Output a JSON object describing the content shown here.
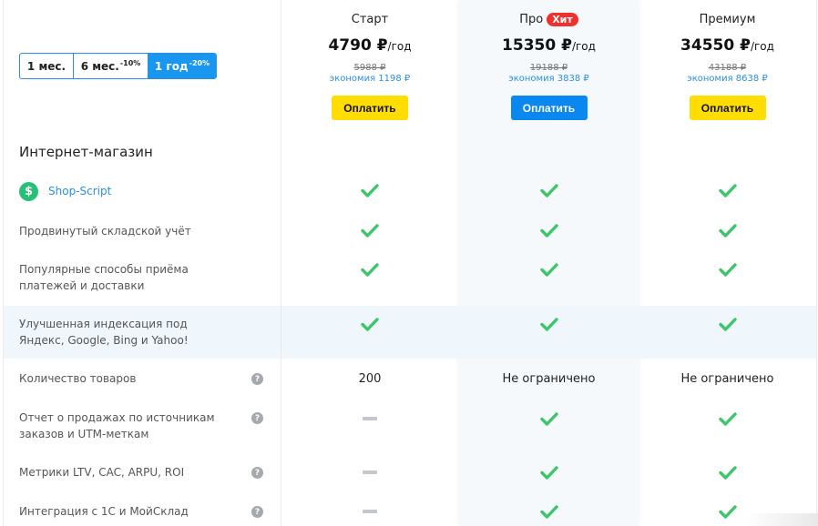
{
  "period_switch": {
    "options": [
      {
        "label": "1 мес.",
        "discount": ""
      },
      {
        "label": "6 мес.",
        "discount": "-10%"
      },
      {
        "label": "1 год",
        "discount": "-20%"
      }
    ],
    "active": "1 год"
  },
  "plans": [
    {
      "name": "Старт",
      "badge": "",
      "price": "4790 ₽",
      "per": "/год",
      "old_price": "5988 ₽",
      "savings": "экономия 1198 ₽",
      "button": "Оплатить",
      "button_color": "#ffdd00"
    },
    {
      "name": "Про",
      "badge": "Хит",
      "price": "15350 ₽",
      "per": "/год",
      "old_price": "19188 ₽",
      "savings": "экономия 3838 ₽",
      "button": "Оплатить",
      "button_color": "#0b87f0"
    },
    {
      "name": "Премиум",
      "badge": "",
      "price": "34550 ₽",
      "per": "/год",
      "old_price": "43188 ₽",
      "savings": "экономия 8638 ₽",
      "button": "Оплатить",
      "button_color": "#ffdd00"
    }
  ],
  "section_title": "Интернет-магазин",
  "features": [
    {
      "label": "Shop-Script",
      "icon": "dollar-icon",
      "is_link": true,
      "help": false,
      "values": [
        "check",
        "check",
        "check"
      ]
    },
    {
      "label_lines": [
        "Продвинутый складской учёт"
      ],
      "help": false,
      "values": [
        "check",
        "check",
        "check"
      ]
    },
    {
      "label_lines": [
        "Популярные способы приёма",
        "платежей и доставки"
      ],
      "help": false,
      "values": [
        "check",
        "check",
        "check"
      ]
    },
    {
      "label_lines": [
        "Улучшенная индексация под",
        "Яндекс, Google, Bing и Yahoo!"
      ],
      "help": false,
      "highlight": true,
      "values": [
        "check",
        "check",
        "check"
      ]
    },
    {
      "label_lines": [
        "Количество товаров"
      ],
      "help": true,
      "values": [
        "200",
        "Не ограничено",
        "Не ограничено"
      ]
    },
    {
      "label_lines": [
        "Отчет о продажах по источникам",
        "заказов и UTM-меткам"
      ],
      "help": true,
      "values": [
        "dash",
        "check",
        "check"
      ]
    },
    {
      "label_lines": [
        "Метрики LTV, CAC, ARPU, ROI"
      ],
      "help": true,
      "values": [
        "dash",
        "check",
        "check"
      ]
    },
    {
      "label_lines": [
        "Интеграция с 1С и МойСклад"
      ],
      "help": true,
      "values": [
        "dash",
        "check",
        "check"
      ]
    }
  ],
  "help_glyph": "?",
  "shop_icon_glyph": "$",
  "colors": {
    "check": "#3cc569",
    "accent": "#2c8fe3",
    "badge": "#f0302c",
    "highlight": "#eff6fc"
  }
}
